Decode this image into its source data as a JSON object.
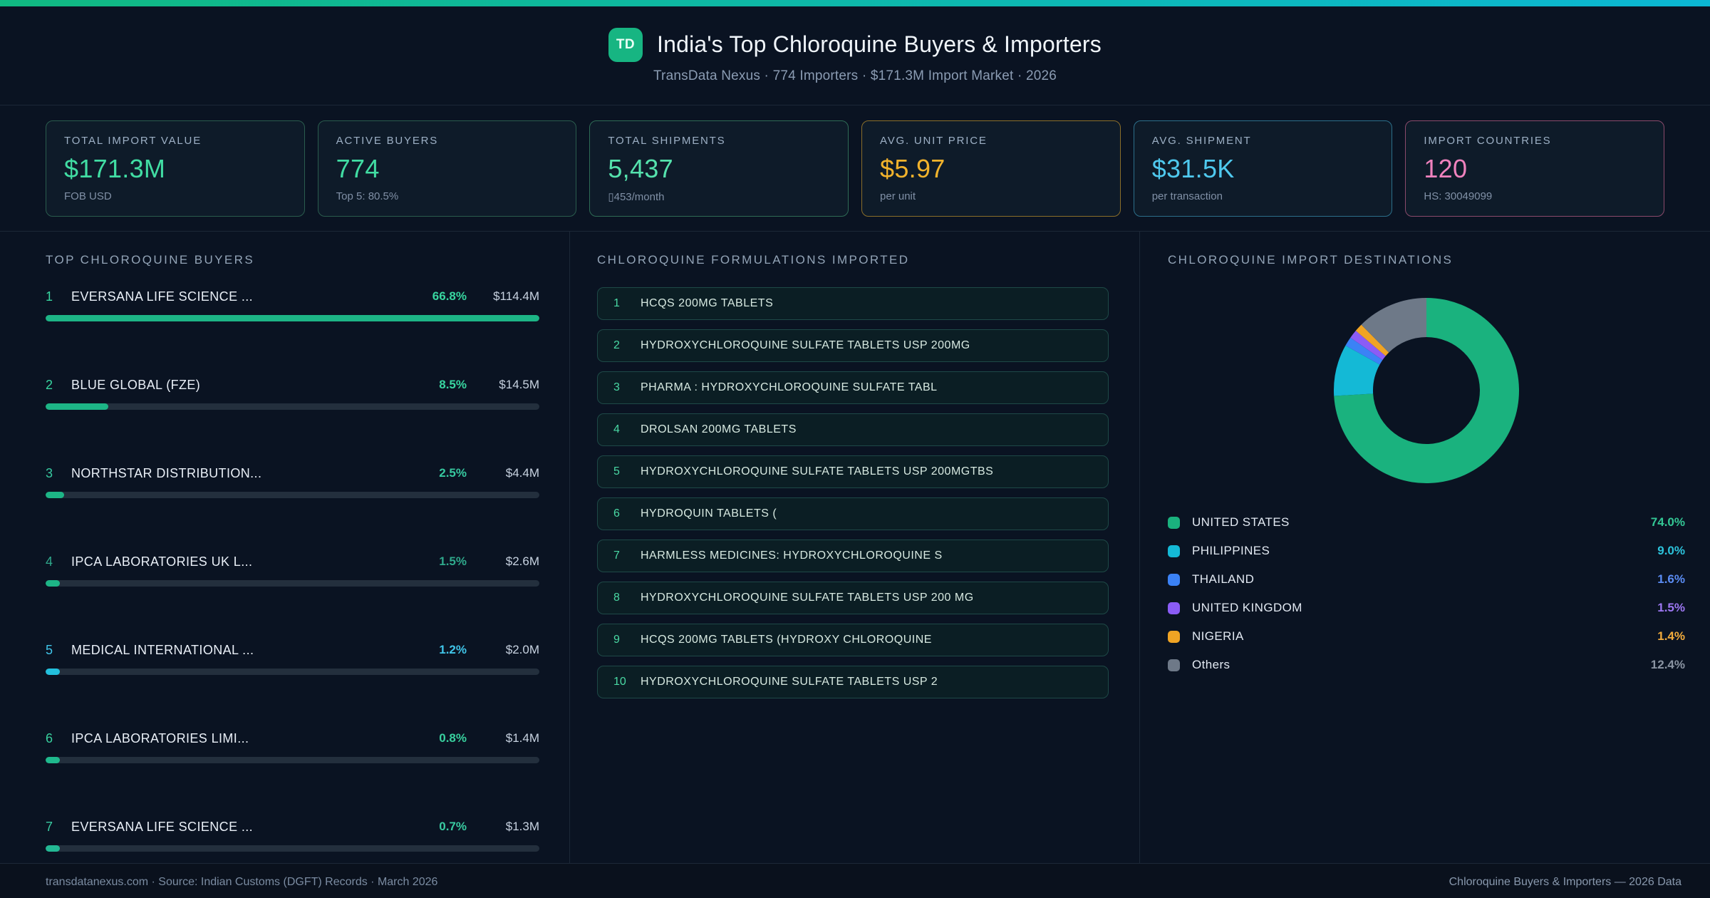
{
  "page": {
    "background": "#0a1322",
    "topbar_gradient": [
      "#10b981",
      "#0bb7d4"
    ]
  },
  "header": {
    "logo_text": "TD",
    "logo_color": "#17b582",
    "title": "India's Top Chloroquine Buyers & Importers",
    "subtitle": "TransData Nexus · 774 Importers · $171.3M Import Market · 2026"
  },
  "kpis": [
    {
      "label": "TOTAL IMPORT VALUE",
      "value": "$171.3M",
      "sub": "FOB USD",
      "value_color": "#41dda3",
      "border_color": "#2a5c4d"
    },
    {
      "label": "ACTIVE BUYERS",
      "value": "774",
      "sub": "Top 5: 80.5%",
      "value_color": "#41dda3",
      "border_color": "#2a5c4d"
    },
    {
      "label": "TOTAL SHIPMENTS",
      "value": "5,437",
      "sub": "▯453/month",
      "value_color": "#55e2ad",
      "border_color": "#2e6b55"
    },
    {
      "label": "AVG. UNIT PRICE",
      "value": "$5.97",
      "sub": "per unit",
      "value_color": "#f2b32c",
      "border_color": "#8a6e2a"
    },
    {
      "label": "AVG. SHIPMENT",
      "value": "$31.5K",
      "sub": "per transaction",
      "value_color": "#4fc9ee",
      "border_color": "#2c6f8a"
    },
    {
      "label": "IMPORT COUNTRIES",
      "value": "120",
      "sub": "HS: 30049099",
      "value_color": "#ef82bd",
      "border_color": "#8a4a6b"
    }
  ],
  "panels": {
    "buyers_heading": "TOP CHLOROQUINE BUYERS",
    "formulations_heading": "CHLOROQUINE FORMULATIONS IMPORTED",
    "destinations_heading": "CHLOROQUINE IMPORT DESTINATIONS"
  },
  "formulations": {
    "items": [
      "HCQS 200MG TABLETS",
      "HYDROXYCHLOROQUINE SULFATE TABLETS USP 200MG",
      "PHARMA : HYDROXYCHLOROQUINE SULFATE TABL",
      "DROLSAN 200MG TABLETS",
      "HYDROXYCHLOROQUINE SULFATE TABLETS USP 200MGTBS",
      "HYDROQUIN TABLETS (",
      "HARMLESS MEDICINES: HYDROXYCHLOROQUINE S",
      "HYDROXYCHLOROQUINE SULFATE TABLETS USP 200 MG",
      "HCQS 200MG TABLETS (HYDROXY CHLOROQUINE",
      "HYDROXYCHLOROQUINE SULFATE TABLETS USP 2"
    ]
  },
  "chart_data": [
    {
      "type": "bar",
      "title": "TOP CHLOROQUINE BUYERS",
      "orientation": "horizontal",
      "categories": [
        "EVERSANA LIFE SCIENCE ...",
        "BLUE GLOBAL (FZE)",
        "NORTHSTAR DISTRIBUTION...",
        "IPCA LABORATORIES UK L...",
        "MEDICAL INTERNATIONAL ...",
        "IPCA LABORATORIES LIMI...",
        "EVERSANA LIFE SCIENCE ..."
      ],
      "values": [
        66.8,
        8.5,
        2.5,
        1.5,
        1.2,
        0.8,
        0.7
      ],
      "value_labels": [
        "66.8%",
        "8.5%",
        "2.5%",
        "1.5%",
        "1.2%",
        "0.8%",
        "0.7%"
      ],
      "secondary_labels": [
        "$114.4M",
        "$14.5M",
        "$4.4M",
        "$2.6M",
        "$2.0M",
        "$1.4M",
        "$1.3M"
      ],
      "accent_colors": [
        "#38d6a0",
        "#38d6a0",
        "#37c9a0",
        "#2fa98c",
        "#40c5e9",
        "#38d09e",
        "#39cba1"
      ],
      "bar_colors": [
        "#1db586",
        "#1db586",
        "#1db586",
        "#1db586",
        "#23c0dd",
        "#1fb98d",
        "#23b894"
      ],
      "track_color": "#232f3d",
      "xlim": [
        0,
        66.8
      ]
    },
    {
      "type": "pie",
      "title": "CHLOROQUINE IMPORT DESTINATIONS",
      "labels": [
        "UNITED STATES",
        "PHILIPPINES",
        "THAILAND",
        "UNITED KINGDOM",
        "NIGERIA",
        "Others"
      ],
      "values": [
        74.0,
        9.0,
        1.6,
        1.5,
        1.4,
        12.4
      ],
      "value_labels": [
        "74.0%",
        "9.0%",
        "1.6%",
        "1.5%",
        "1.4%",
        "12.4%"
      ],
      "colors": [
        "#1ab27e",
        "#14b9d6",
        "#3b82f6",
        "#8b5cf6",
        "#f0a424",
        "#6e7988"
      ],
      "value_label_colors": [
        "#33c795",
        "#2cc3dc",
        "#5b8df5",
        "#9d77f2",
        "#f2ac3c",
        "#8a94a2"
      ],
      "hole": 0.58,
      "legend_position": "bottom"
    }
  ],
  "footer": {
    "left": "transdatanexus.com · Source: Indian Customs (DGFT) Records · March 2026",
    "right": "Chloroquine Buyers & Importers — 2026 Data"
  }
}
